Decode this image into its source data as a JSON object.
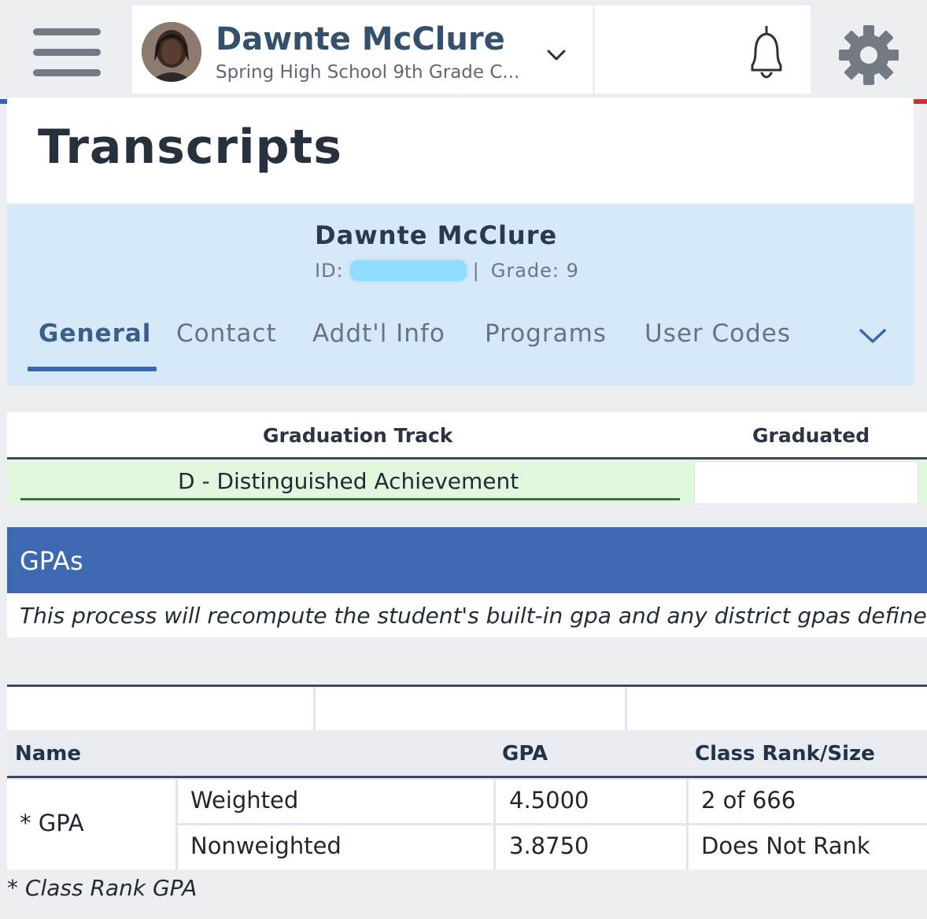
{
  "header": {
    "profile_name": "Dawnte McClure",
    "profile_school": "Spring High School 9th Grade C..."
  },
  "page": {
    "title": "Transcripts"
  },
  "student": {
    "name": "Dawnte McClure",
    "id_label": "ID:",
    "separator": "|",
    "grade_text": "Grade: 9"
  },
  "tabs": [
    {
      "label": "General",
      "active": true
    },
    {
      "label": "Contact",
      "active": false
    },
    {
      "label": "Addt'l Info",
      "active": false
    },
    {
      "label": "Programs",
      "active": false
    },
    {
      "label": "User Codes",
      "active": false
    }
  ],
  "graduation": {
    "track_header": "Graduation Track",
    "graduated_header": "Graduated",
    "track_value": "D - Distinguished Achievement",
    "graduated_value": ""
  },
  "gpas": {
    "title": "GPAs",
    "description": "This process will recompute the student's built-in gpa and any district gpas defined",
    "columns": {
      "name": "Name",
      "gpa": "GPA",
      "rank": "Class Rank/Size"
    },
    "group_name": "* GPA",
    "rows": [
      {
        "type": "Weighted",
        "gpa": "4.5000",
        "rank": "2 of 666"
      },
      {
        "type": "Nonweighted",
        "gpa": "3.8750",
        "rank": "Does Not Rank"
      }
    ],
    "footnote": "* Class Rank GPA"
  },
  "colors": {
    "accent_blue": "#3c69b2",
    "student_card_bg": "#d6e9f8",
    "track_row_bg": "#e1f8df",
    "track_underline": "#2d7a3d",
    "accent_red": "#c9313a"
  },
  "icons": {
    "menu": "hamburger-icon",
    "dropdown": "chevron-down-icon",
    "notifications": "bell-icon",
    "settings": "gear-icon"
  }
}
